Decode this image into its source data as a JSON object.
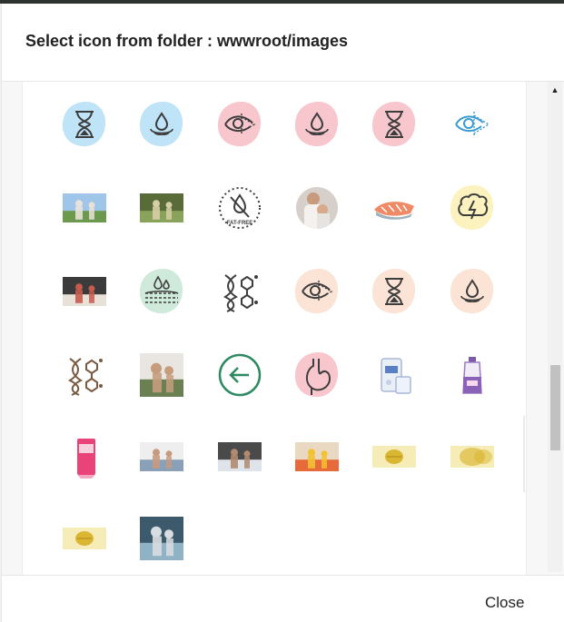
{
  "dialog": {
    "title": "Select icon from folder : wwwroot/images",
    "close_label": "Close"
  },
  "fat_free_text": "FAT-FREE",
  "colors": {
    "blue_blob": "#bfe3f7",
    "pink_blob": "#f8c7ce",
    "peach_blob": "#fbe3d6",
    "green_blob": "#cfe9db",
    "yellow_blob": "#fbf2bf",
    "icon_dark": "#3d3d3d",
    "icon_blue": "#3a9bd1",
    "icon_green": "#2f8a63",
    "icon_brown": "#7a5a40"
  },
  "icons": [
    {
      "name": "hourglass-blue-icon",
      "kind": "hourglass",
      "bg": "blue"
    },
    {
      "name": "water-drop-blue-icon",
      "kind": "drop",
      "bg": "blue"
    },
    {
      "name": "eye-pink-icon",
      "kind": "eye",
      "bg": "pink"
    },
    {
      "name": "water-drop-pink-icon",
      "kind": "drop",
      "bg": "pink"
    },
    {
      "name": "hourglass-pink-icon",
      "kind": "hourglass",
      "bg": "pink"
    },
    {
      "name": "eye-line-blue-icon",
      "kind": "eye-line",
      "bg": "none"
    },
    {
      "name": "family-field-photo",
      "kind": "photo-family"
    },
    {
      "name": "garden-photo",
      "kind": "photo-garden"
    },
    {
      "name": "fat-free-badge-icon",
      "kind": "fatfree"
    },
    {
      "name": "mother-child-photo",
      "kind": "photo-circle"
    },
    {
      "name": "salmon-fillet-icon",
      "kind": "salmon"
    },
    {
      "name": "brain-lightning-icon",
      "kind": "brain",
      "bg": "yellow"
    },
    {
      "name": "family-sofa-photo",
      "kind": "photo-sofa"
    },
    {
      "name": "skin-layers-icon",
      "kind": "skin",
      "bg": "green"
    },
    {
      "name": "dna-molecule-icon",
      "kind": "dna"
    },
    {
      "name": "eye-peach-icon",
      "kind": "eye",
      "bg": "peach"
    },
    {
      "name": "hourglass-peach-icon",
      "kind": "hourglass",
      "bg": "peach"
    },
    {
      "name": "water-drop-peach-icon",
      "kind": "drop",
      "bg": "peach"
    },
    {
      "name": "dna-molecule-brown-icon",
      "kind": "dna-brown"
    },
    {
      "name": "father-child-photo",
      "kind": "photo-father"
    },
    {
      "name": "back-arrow-circle-icon",
      "kind": "back-arrow"
    },
    {
      "name": "stomach-icon",
      "kind": "stomach",
      "bg": "pink"
    },
    {
      "name": "supplement-pack-icon",
      "kind": "pack"
    },
    {
      "name": "purple-bottle-icon",
      "kind": "bottle"
    },
    {
      "name": "pink-product-box-icon",
      "kind": "pinkbox"
    },
    {
      "name": "couple-photo",
      "kind": "photo-couple"
    },
    {
      "name": "relaxing-photo",
      "kind": "photo-relax"
    },
    {
      "name": "fruit-bowl-photo",
      "kind": "photo-fruit"
    },
    {
      "name": "capsule-yellow-icon",
      "kind": "capsule"
    },
    {
      "name": "capsule-blurred-icon",
      "kind": "capsule-blur"
    },
    {
      "name": "capsule-yellow-2-icon",
      "kind": "capsule"
    },
    {
      "name": "yoga-photo",
      "kind": "photo-yoga"
    }
  ]
}
